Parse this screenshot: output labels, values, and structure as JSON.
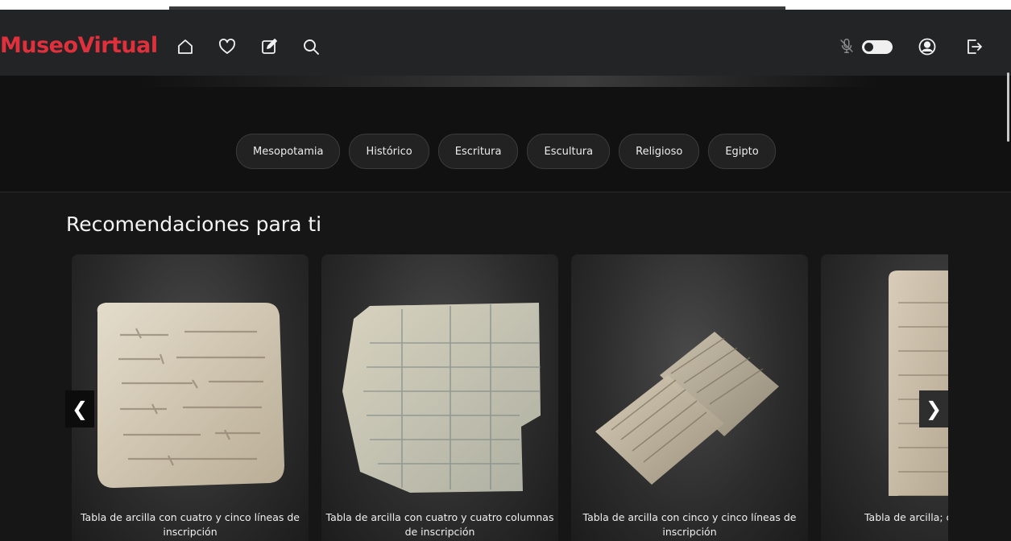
{
  "brand": {
    "name": "MuseoVirtual",
    "color": "#e0303c"
  },
  "nav": {
    "left_icons": [
      "home-icon",
      "heart-icon",
      "edit-icon",
      "search-icon"
    ],
    "right_icons": [
      "mic-off-icon",
      "user-circle-icon",
      "logout-icon"
    ]
  },
  "categories": [
    "Mesopotamia",
    "Histórico",
    "Escritura",
    "Escultura",
    "Religioso",
    "Egipto"
  ],
  "recommendations": {
    "title": "Recomendaciones para ti",
    "items": [
      {
        "caption": "Tabla de arcilla con cuatro y cinco líneas de inscripción"
      },
      {
        "caption": "Tabla de arcilla con cuatro y cuatro columnas de inscripción"
      },
      {
        "caption": "Tabla de arcilla con cinco y cinco líneas de inscripción"
      },
      {
        "caption": "Tabla de arcilla; cartucho nasi"
      }
    ],
    "prev_label": "❮",
    "next_label": "❯"
  }
}
